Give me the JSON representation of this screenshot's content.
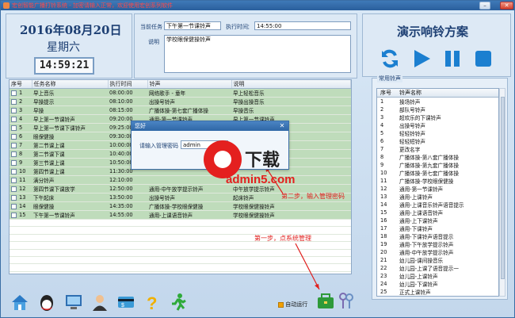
{
  "window": {
    "title": "宏创智能广播打铃系统 - 加密请输入正常，欢迎使用宏创系列软件",
    "minimize_glyph": "–",
    "maximize_glyph": "□",
    "close_glyph": "✕"
  },
  "clock": {
    "date": "2016年08月20日",
    "weekday": "星期六",
    "time": "14:59:21"
  },
  "task": {
    "current_label": "当前任务",
    "current_value": "下午第一节课铃声",
    "exec_time_label": "执行时间",
    "exec_time_value": "14:55:00",
    "note_label": "说明",
    "note_value": "学校眼保健操铃声"
  },
  "plan": {
    "title": "演示响铃方案",
    "controls": [
      "refresh-icon",
      "play-icon",
      "pause-icon",
      "stop-icon"
    ]
  },
  "schedule": {
    "columns": [
      "序号",
      "任务名称",
      "执行时间",
      "铃声",
      "说明"
    ],
    "rows": [
      {
        "no": "1",
        "name": "早上音乐",
        "time": "08:00:00",
        "bell": "网络歌手 - 童年",
        "note": "早上轻松音乐",
        "active": true
      },
      {
        "no": "2",
        "name": "早操提示",
        "time": "08:10:00",
        "bell": "出操号铃声",
        "note": "早操出操音乐",
        "active": true
      },
      {
        "no": "3",
        "name": "早操",
        "time": "08:15:00",
        "bell": "广播体操-第七套广播体操",
        "note": "早操音乐",
        "active": true
      },
      {
        "no": "4",
        "name": "早上第一节课铃声",
        "time": "09:20:00",
        "bell": "通用-第一节课铃声",
        "note": "早上第一节课铃声",
        "active": true
      },
      {
        "no": "5",
        "name": "早上第一节课下课铃声",
        "time": "09:25:00",
        "bell": "",
        "note": "",
        "active": true
      },
      {
        "no": "6",
        "name": "眼保健操",
        "time": "09:30:00",
        "bell": "",
        "note": "",
        "active": true
      },
      {
        "no": "7",
        "name": "第二节课上课",
        "time": "10:00:00",
        "bell": "",
        "note": "",
        "active": true
      },
      {
        "no": "8",
        "name": "第二节课下课",
        "time": "10:40:00",
        "bell": "",
        "note": "",
        "active": true
      },
      {
        "no": "9",
        "name": "第三节课上课",
        "time": "10:50:00",
        "bell": "",
        "note": "",
        "active": true
      },
      {
        "no": "10",
        "name": "第四节课上课",
        "time": "11:30:00",
        "bell": "",
        "note": "",
        "active": true
      },
      {
        "no": "11",
        "name": "满分铃声",
        "time": "12:10:00",
        "bell": "",
        "note": "",
        "active": true
      },
      {
        "no": "12",
        "name": "第四节课下课放学",
        "time": "12:50:00",
        "bell": "通用-中午放学提示铃声",
        "note": "中午放学提示铃声",
        "active": true
      },
      {
        "no": "13",
        "name": "下午起床",
        "time": "13:50:00",
        "bell": "出操号铃声",
        "note": "起床铃声",
        "active": true
      },
      {
        "no": "14",
        "name": "眼保健操",
        "time": "14:35:00",
        "bell": "广播体操-学校眼保健操",
        "note": "学校眼保健操铃声",
        "active": true
      },
      {
        "no": "15",
        "name": "下午第一节课铃声",
        "time": "14:55:00",
        "bell": "通用-上课语音铃声",
        "note": "学校眼保健操铃声",
        "active": true
      }
    ]
  },
  "bell_list": {
    "group_label": "常用铃声",
    "columns": [
      "序号",
      "铃声名称"
    ],
    "rows": [
      {
        "no": "1",
        "name": "操场铃声"
      },
      {
        "no": "2",
        "name": "部队号铃声"
      },
      {
        "no": "3",
        "name": "超欢乐的下课铃声"
      },
      {
        "no": "4",
        "name": "出操号铃声"
      },
      {
        "no": "5",
        "name": "轻轻铃铃声"
      },
      {
        "no": "6",
        "name": "轻轻短铃声"
      },
      {
        "no": "7",
        "name": "更改名字"
      },
      {
        "no": "8",
        "name": "广播体操-第八套广播体操"
      },
      {
        "no": "9",
        "name": "广播体操-第九套广播体操"
      },
      {
        "no": "10",
        "name": "广播体操-第七套广播体操"
      },
      {
        "no": "11",
        "name": "广播体操-学校眼保健操"
      },
      {
        "no": "12",
        "name": "通用-第一节课铃声"
      },
      {
        "no": "13",
        "name": "通用-上课铃声"
      },
      {
        "no": "14",
        "name": "通用-上课音乐铃声语音提示"
      },
      {
        "no": "15",
        "name": "通用-上课语音铃声"
      },
      {
        "no": "16",
        "name": "通用-上下课铃声"
      },
      {
        "no": "17",
        "name": "通用-下课铃声"
      },
      {
        "no": "18",
        "name": "通用-下课铃声语音提示"
      },
      {
        "no": "19",
        "name": "通用-下午放学提示铃声"
      },
      {
        "no": "20",
        "name": "通用-中午放学提示铃声"
      },
      {
        "no": "21",
        "name": "幼儿园-课间操音乐"
      },
      {
        "no": "22",
        "name": "幼儿园-上课了语音提示一"
      },
      {
        "no": "23",
        "name": "幼儿园-上课铃声"
      },
      {
        "no": "24",
        "name": "幼儿园-下课铃声"
      },
      {
        "no": "25",
        "name": "正式上课铃声"
      }
    ]
  },
  "dialog": {
    "title": "您好",
    "password_label": "请输入管理密码",
    "password_value": "admin",
    "close_glyph": "✕"
  },
  "watermark": {
    "brand": "a5",
    "brand_cn": "下载",
    "site": "admin5.com"
  },
  "annotations": {
    "step1": "第一步，点系统管理",
    "step2": "第二步，输入管理密码"
  },
  "footer": {
    "autorun_label": "自动运行",
    "autorun_checked": true,
    "icons": [
      "home-icon",
      "qq-icon",
      "monitor-icon",
      "users-icon",
      "card-icon",
      "help-icon",
      "exit-icon"
    ],
    "right_icons": [
      "system-manage-icon",
      "keys-icon"
    ]
  },
  "colors": {
    "accent": "#1d3f73",
    "active_row": "#bfdcbb",
    "annotation": "#e0201e",
    "title_text": "#ff4a4a"
  }
}
